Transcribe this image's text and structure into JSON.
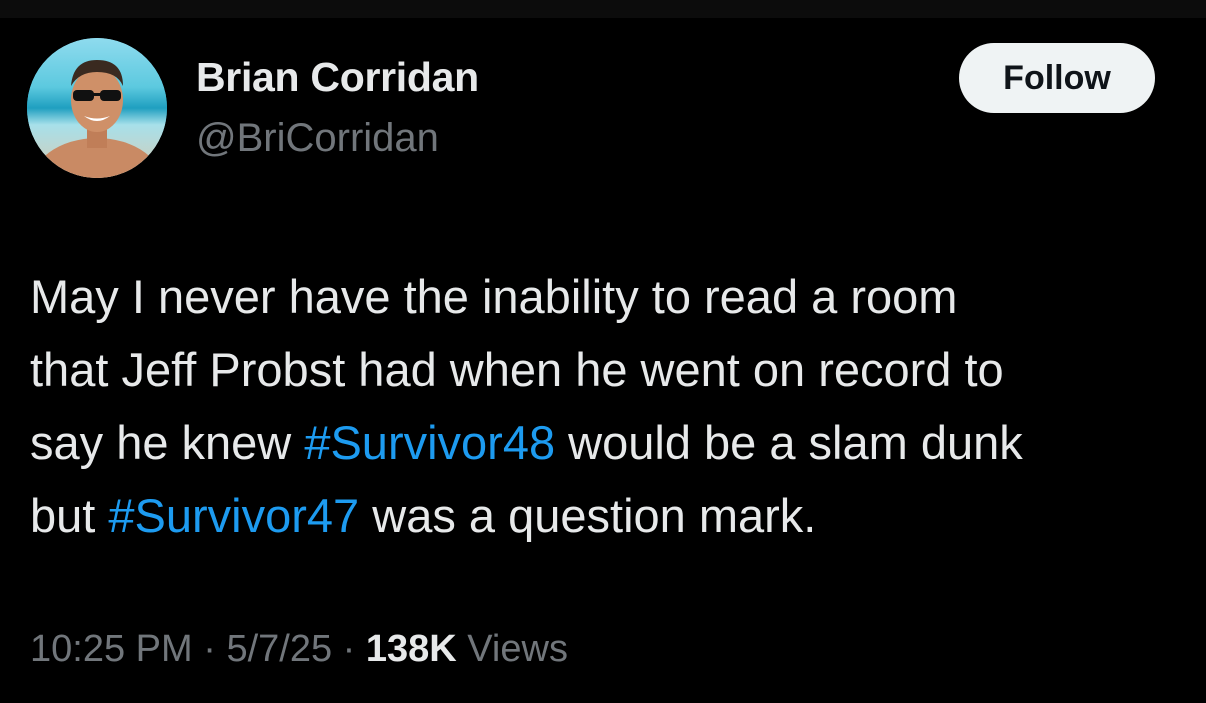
{
  "author": {
    "name": "Brian Corridan",
    "handle": "@BriCorridan"
  },
  "follow_button": {
    "label": "Follow"
  },
  "tweet": {
    "lines": [
      [
        {
          "text": "May I never have the inability to read a room"
        }
      ],
      [
        {
          "text": "that Jeff Probst had when he went on record to"
        }
      ],
      [
        {
          "text": "say he knew "
        },
        {
          "text": "#Survivor48",
          "hashtag": true
        },
        {
          "text": " would be a slam dunk"
        }
      ],
      [
        {
          "text": "but "
        },
        {
          "text": "#Survivor47",
          "hashtag": true
        },
        {
          "text": " was a question mark."
        }
      ]
    ]
  },
  "meta": {
    "time": "10:25 PM",
    "separator": " · ",
    "date": "5/7/25",
    "views_count": "138K",
    "views_label": " Views"
  },
  "colors": {
    "background": "#000000",
    "text": "#e7e9ea",
    "secondary": "#71767b",
    "hashtag": "#1d9bf0",
    "follow_bg": "#eff3f4"
  }
}
